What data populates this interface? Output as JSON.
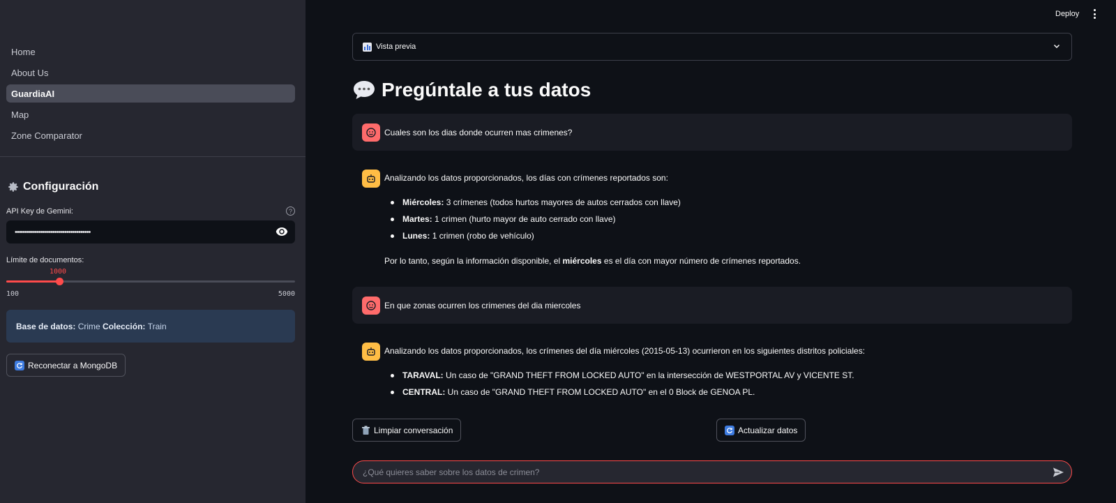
{
  "sidebar": {
    "nav": [
      "Home",
      "About Us",
      "GuardiaAI",
      "Map",
      "Zone Comparator"
    ],
    "active": "GuardiaAI",
    "config_title": "Configuración",
    "api_key_label": "API Key de Gemini:",
    "api_key_value": "••••••••••••••••••••••••••••••••••••••",
    "limit_label": "Límite de documentos:",
    "slider": {
      "value": "1000",
      "min": "100",
      "max": "5000",
      "fraction": 0.1837
    },
    "db_info": {
      "db_label": "Base de datos:",
      "db_value": "Crime",
      "coll_label": "Colección:",
      "coll_value": "Train"
    },
    "reconnect_label": "Reconectar a MongoDB"
  },
  "header": {
    "deploy": "Deploy"
  },
  "main": {
    "expander_label": "Vista previa",
    "title": "Pregúntale a tus datos",
    "messages": {
      "q1": "Cuales son los dias donde ocurren mas crimenes?",
      "a1_intro": "Analizando los datos proporcionados, los días con crímenes reportados son:",
      "a1_items": [
        {
          "bold": "Miércoles:",
          "text": "3 crímenes (todos hurtos mayores de autos cerrados con llave)"
        },
        {
          "bold": "Martes:",
          "text": "1 crimen (hurto mayor de auto cerrado con llave)"
        },
        {
          "bold": "Lunes:",
          "text": "1 crimen (robo de vehículo)"
        }
      ],
      "a1_conclusion_pre": "Por lo tanto, según la información disponible, el",
      "a1_conclusion_bold": "miércoles",
      "a1_conclusion_post": "es el día con mayor número de crímenes reportados.",
      "q2": "En que zonas ocurren los crimenes del dia miercoles",
      "a2_intro": "Analizando los datos proporcionados, los crímenes del día miércoles (2015-05-13) ocurrieron en los siguientes distritos policiales:",
      "a2_items": [
        {
          "bold": "TARAVAL:",
          "text": "Un caso de \"GRAND THEFT FROM LOCKED AUTO\" en la intersección de WESTPORTAL AV y VICENTE ST."
        },
        {
          "bold": "CENTRAL:",
          "text": "Un caso de \"GRAND THEFT FROM LOCKED AUTO\" en el 0 Block de GENOA PL."
        }
      ]
    },
    "clear_label": "Limpiar conversación",
    "refresh_label": "Actualizar datos",
    "chat_placeholder": "¿Qué quieres saber sobre los datos de crimen?"
  },
  "colors": {
    "accent": "#ff4b4b",
    "sidebar_bg": "#262730",
    "main_bg": "#0e1117",
    "info_bg": "#2a3a52",
    "user_avatar": "#ff6b6b",
    "bot_avatar": "#ffbd45"
  },
  "icons": [
    "gear-icon",
    "help-icon",
    "eye-icon",
    "refresh-icon",
    "chart-icon",
    "chevron-down-icon",
    "speech-bubble-icon",
    "user-avatar-icon",
    "bot-avatar-icon",
    "trash-icon",
    "send-icon",
    "kebab-menu-icon"
  ]
}
